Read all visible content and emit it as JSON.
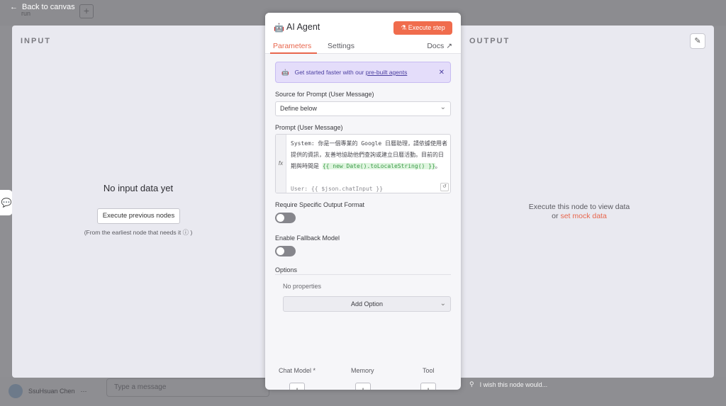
{
  "canvas": {
    "back_label": "Back to canvas",
    "tab_label": "run",
    "user_name": "SsuHsuan Chen",
    "message_placeholder": "Type a message",
    "feedback_text": "I wish this node would..."
  },
  "input_panel": {
    "label": "INPUT",
    "empty_title": "No input data yet",
    "execute_button": "Execute previous nodes",
    "note": "(From the earliest node that needs it ⓘ )"
  },
  "output_panel": {
    "label": "OUTPUT",
    "message_line1": "Execute this node to view data",
    "message_or": "or ",
    "mock_link": "set mock data"
  },
  "dialog": {
    "title": "AI Agent",
    "execute_button": "Execute step",
    "tabs": [
      "Parameters",
      "Settings",
      "Docs"
    ],
    "banner": {
      "text": "Get started faster with our ",
      "link": "pre-built agents"
    },
    "source_label": "Source for Prompt (User Message)",
    "source_value": "Define below",
    "prompt_label": "Prompt (User Message)",
    "prompt": {
      "fx": "fx",
      "text_main": "System: 你是一個專業的 Google 日曆助理，請依據使用者提供的資訊，友善地協助他們查詢或建立日曆活動。目前的日期與時間是 ",
      "expression": "{{ new Date().toLocaleString() }}",
      "text_end": "。",
      "user_line": "User: {{ $json.chatInput }}"
    },
    "output_format_label": "Require Specific Output Format",
    "fallback_label": "Enable Fallback Model",
    "options_label": "Options",
    "no_properties": "No properties",
    "add_option": "Add Option",
    "connectors": [
      "Chat Model *",
      "Memory",
      "Tool"
    ]
  },
  "colors": {
    "accent": "#e8664d",
    "panel_bg": "#e9e9f0",
    "banner_bg": "#e4ddfa"
  }
}
